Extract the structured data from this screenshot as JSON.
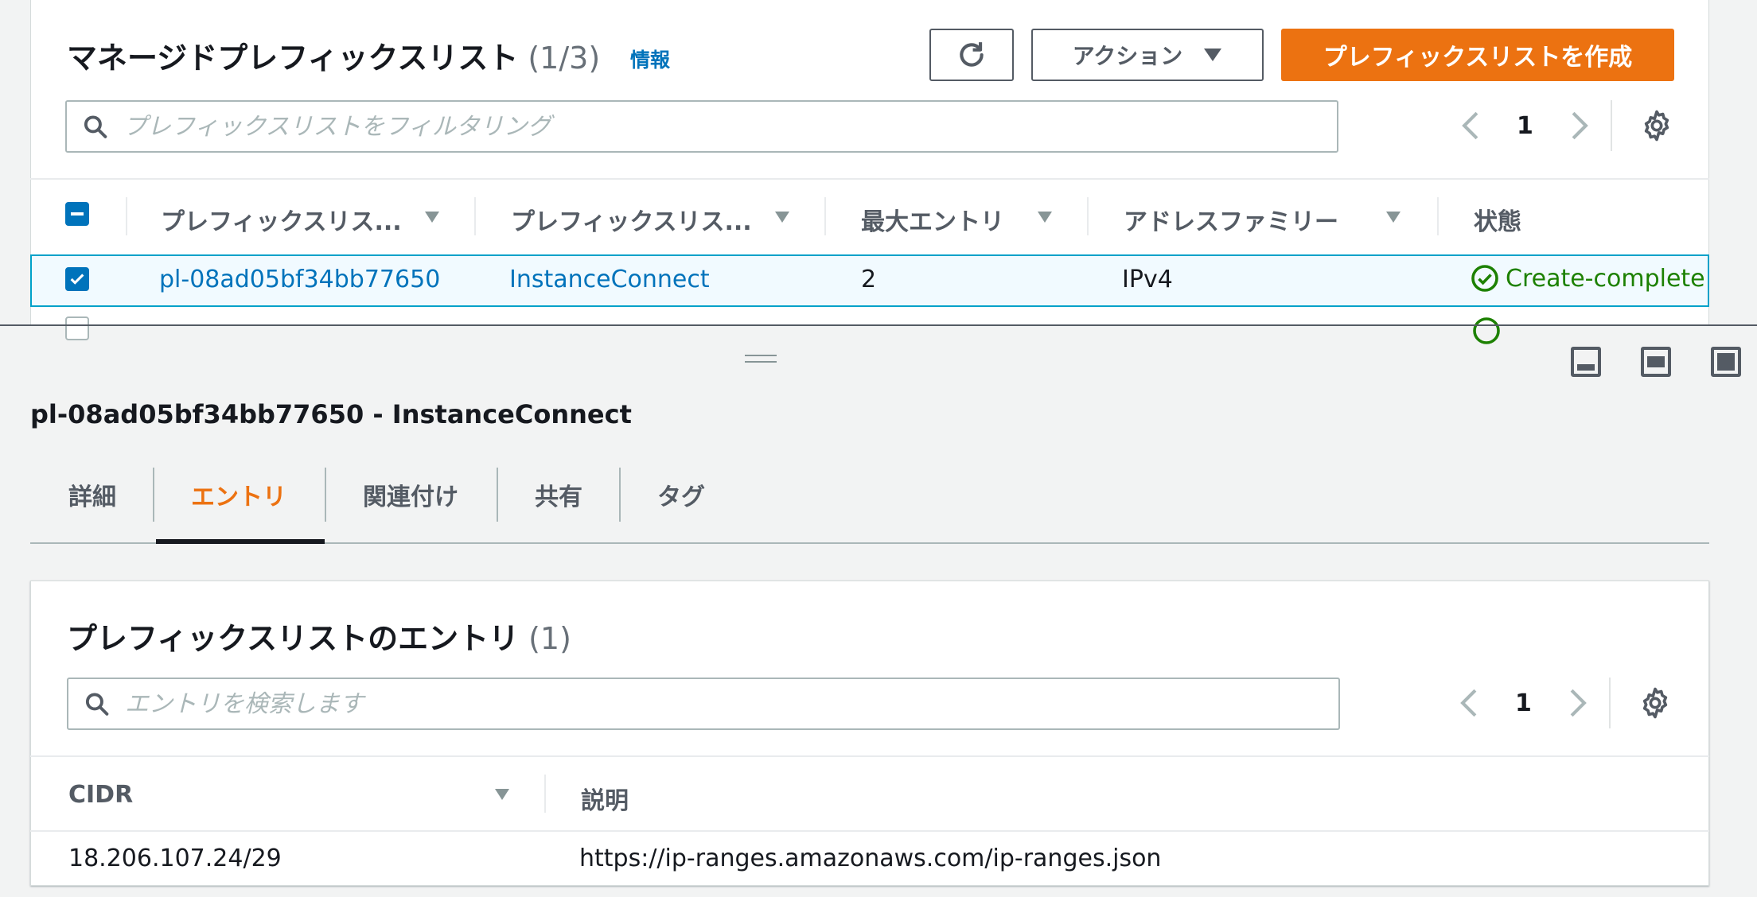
{
  "list": {
    "title": "マネージドプレフィックスリスト",
    "count": "(1/3)",
    "info": "情報",
    "actions_label": "アクション",
    "create_label": "プレフィックスリストを作成",
    "search_placeholder": "プレフィックスリストをフィルタリング",
    "page": "1",
    "columns": [
      "プレフィックスリス...",
      "プレフィックスリス...",
      "最大エントリ",
      "アドレスファミリー",
      "状態"
    ],
    "selected_row": {
      "id": "pl-08ad05bf34bb77650",
      "name": "InstanceConnect",
      "max_entries": "2",
      "address_family": "IPv4",
      "state": "Create-complete"
    }
  },
  "detail": {
    "title": "pl-08ad05bf34bb77650 - InstanceConnect",
    "tabs": [
      "詳細",
      "エントリ",
      "関連付け",
      "共有",
      "タグ"
    ],
    "active_tab": "エントリ"
  },
  "entries": {
    "title": "プレフィックスリストのエントリ",
    "count": "(1)",
    "search_placeholder": "エントリを検索します",
    "page": "1",
    "columns": [
      "CIDR",
      "説明"
    ],
    "rows": [
      {
        "cidr": "18.206.107.24/29",
        "description": "https://ip-ranges.amazonaws.com/ip-ranges.json"
      }
    ]
  },
  "colors": {
    "primary": "#ec7211",
    "link": "#0073bb",
    "success": "#1d8102",
    "selection_border": "#00a1c9"
  }
}
